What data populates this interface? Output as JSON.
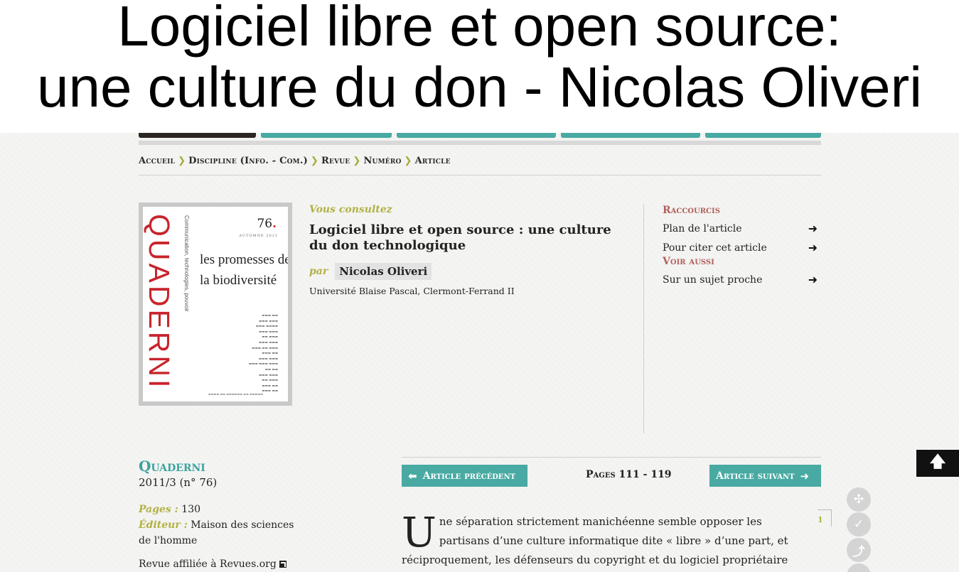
{
  "banner": {
    "line1": "Logiciel libre et open source:",
    "line2": "une culture du don - Nicolas Oliveri"
  },
  "nav_tab_colors": [
    "#2c2624",
    "#48aaa3",
    "#48aaa3",
    "#48aaa3",
    "#48aaa3"
  ],
  "breadcrumb": [
    "Accueil",
    "Discipline (Info. - Com.)",
    "Revue",
    "Numéro",
    "Article"
  ],
  "breadcrumb_sep": "❯",
  "cover": {
    "brand": "QUADERNI",
    "subtitle": "Communication, technologies, pouvoir",
    "number": "76",
    "season": "AUTOMNE 2011",
    "theme_line1": "les promesses de",
    "theme_line2": "la biodiversité"
  },
  "consult": {
    "label": "Vous consultez",
    "title": "Logiciel libre et open source : une culture du don technologique",
    "par": "par",
    "author": "Nicolas Oliveri",
    "affiliation": "Université Blaise Pascal, Clermont-Ferrand II"
  },
  "shortcuts": {
    "header": "Raccourcis",
    "items": [
      "Plan de l'article",
      "Pour citer cet article"
    ],
    "see_also_header": "Voir aussi",
    "see_also_items": [
      "Sur un sujet proche"
    ]
  },
  "journal": {
    "name": "Quaderni",
    "issue": "2011/3 (n° 76)",
    "pages_label": "Pages :",
    "pages_value": "130",
    "publisher_label": "Éditeur :",
    "publisher_value": "Maison des sciences de l'homme",
    "affiliation": "Revue affiliée à Revues.org"
  },
  "article_nav": {
    "prev": "Article précédent",
    "pages": "Pages 111 - 119",
    "next": "Article suivant"
  },
  "body": {
    "dropcap": "U",
    "text": "ne séparation strictement manichéenne semble opposer les partisans d’une culture informatique dite « libre » d’une part, et réciproquement, les défenseurs du copyright et du logiciel propriétaire d’autre part, ces derniers",
    "para_number": "1"
  },
  "tools": [
    "share-icon",
    "add-alert-icon",
    "pdf-icon",
    "print-icon"
  ],
  "colors": {
    "accent_teal": "#48aaa3",
    "olive": "#b1b144",
    "rose": "#b0605c"
  }
}
